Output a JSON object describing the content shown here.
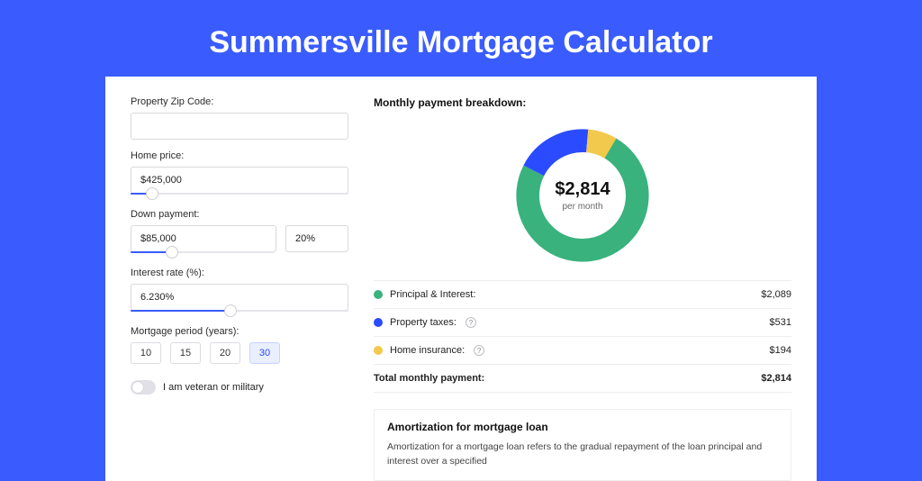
{
  "title": "Summersville Mortgage Calculator",
  "colors": {
    "green": "#39b27d",
    "blue": "#2a4bff",
    "yellow": "#f2c94c"
  },
  "form": {
    "zip": {
      "label": "Property Zip Code:",
      "value": ""
    },
    "price": {
      "label": "Home price:",
      "value": "$425,000",
      "slider_pct": 10
    },
    "down": {
      "label": "Down payment:",
      "value": "$85,000",
      "pct": "20%",
      "slider_pct": 29
    },
    "rate": {
      "label": "Interest rate (%):",
      "value": "6.230%",
      "slider_pct": 46
    },
    "period": {
      "label": "Mortgage period (years):",
      "options": [
        "10",
        "15",
        "20",
        "30"
      ],
      "active": "30"
    },
    "veteran_label": "I am veteran or military",
    "veteran_on": false
  },
  "summary": {
    "header": "Monthly payment breakdown:",
    "amount": "$2,814",
    "per_month": "per month",
    "rows": [
      {
        "color": "green",
        "label": "Principal & Interest:",
        "info": false,
        "value": "$2,089"
      },
      {
        "color": "blue",
        "label": "Property taxes:",
        "info": true,
        "value": "$531"
      },
      {
        "color": "yellow",
        "label": "Home insurance:",
        "info": true,
        "value": "$194"
      }
    ],
    "total_label": "Total monthly payment:",
    "total_value": "$2,814"
  },
  "amort": {
    "header": "Amortization for mortgage loan",
    "text": "Amortization for a mortgage loan refers to the gradual repayment of the loan principal and interest over a specified"
  },
  "chart_data": {
    "type": "pie",
    "title": "Monthly payment breakdown",
    "unit": "USD/month",
    "total": 2814,
    "series": [
      {
        "name": "Principal & Interest",
        "value": 2089,
        "color": "#39b27d"
      },
      {
        "name": "Property taxes",
        "value": 531,
        "color": "#2a4bff"
      },
      {
        "name": "Home insurance",
        "value": 194,
        "color": "#f2c94c"
      }
    ]
  }
}
